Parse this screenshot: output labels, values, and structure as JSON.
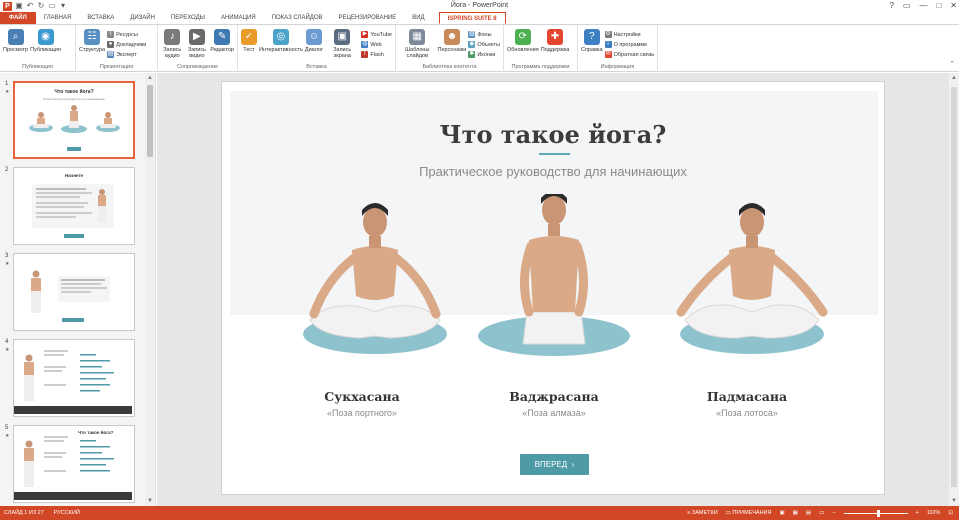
{
  "window": {
    "title": "Йога - PowerPoint",
    "controls": [
      "?",
      "▭",
      "—",
      "□",
      "✕"
    ]
  },
  "tabs": {
    "file": "ФАЙЛ",
    "items": [
      "ГЛАВНАЯ",
      "ВСТАВКА",
      "ДИЗАЙН",
      "ПЕРЕХОДЫ",
      "АНИМАЦИЯ",
      "ПОКАЗ СЛАЙДОВ",
      "РЕЦЕНЗИРОВАНИЕ",
      "ВИД"
    ],
    "active": "ISPRING SUITE 8"
  },
  "ribbon": {
    "groups": [
      {
        "label": "Публикация",
        "buttons": [
          "Просмотр",
          "Публикация"
        ]
      },
      {
        "label": "Презентация",
        "buttons": [
          "Структура"
        ],
        "small": [
          "Ресурсы",
          "Докладчики",
          "Эксперт"
        ]
      },
      {
        "label": "Сопровождение",
        "buttons": [
          "Запись аудио",
          "Запись видео",
          "Редактор"
        ]
      },
      {
        "label": "Вставка",
        "buttons": [
          "Тест",
          "Интерактивность",
          "Диалог",
          "Запись экрана"
        ],
        "small": [
          "YouTube",
          "Web",
          "Flash"
        ]
      },
      {
        "label": "Библиотека контента",
        "buttons": [
          "Шаблоны слайдов",
          "Персонажи"
        ],
        "small": [
          "Фоны",
          "Объекты",
          "Иконки"
        ]
      },
      {
        "label": "Программа поддержки",
        "buttons": [
          "Обновления",
          "Поддержка"
        ]
      },
      {
        "label": "Информация",
        "buttons": [
          "Справка"
        ],
        "small": [
          "Настройки",
          "О программе",
          "Обратная связь"
        ]
      }
    ]
  },
  "thumbnails": [
    {
      "num": "1",
      "title": "Что такое йога?",
      "subtitle": "Практическое руководство для начинающих",
      "selected": true
    },
    {
      "num": "2",
      "title": "Начнете"
    },
    {
      "num": "3"
    },
    {
      "num": "4",
      "title": "Что такое йога?"
    },
    {
      "num": "5",
      "title": "Что такое йога?"
    }
  ],
  "slide": {
    "title": "Что такое йога?",
    "subtitle": "Практическое руководство для начинающих",
    "poses": [
      {
        "name": "Сукхасана",
        "sub": "«Поза портного»"
      },
      {
        "name": "Ваджрасана",
        "sub": "«Поза алмаза»"
      },
      {
        "name": "Падмасана",
        "sub": "«Поза лотоса»"
      }
    ],
    "next_button": "ВПЕРЕД"
  },
  "status": {
    "slide_info": "СЛАЙД 1 ИЗ 27",
    "language": "РУССКИЙ",
    "notes": "ЗАМЕТКИ",
    "comments": "ПРИМЕЧАНИЯ",
    "zoom": "110%"
  },
  "colors": {
    "accent": "#d24726",
    "teal": "#4e9aa7",
    "mat": "#8ec3cd"
  }
}
